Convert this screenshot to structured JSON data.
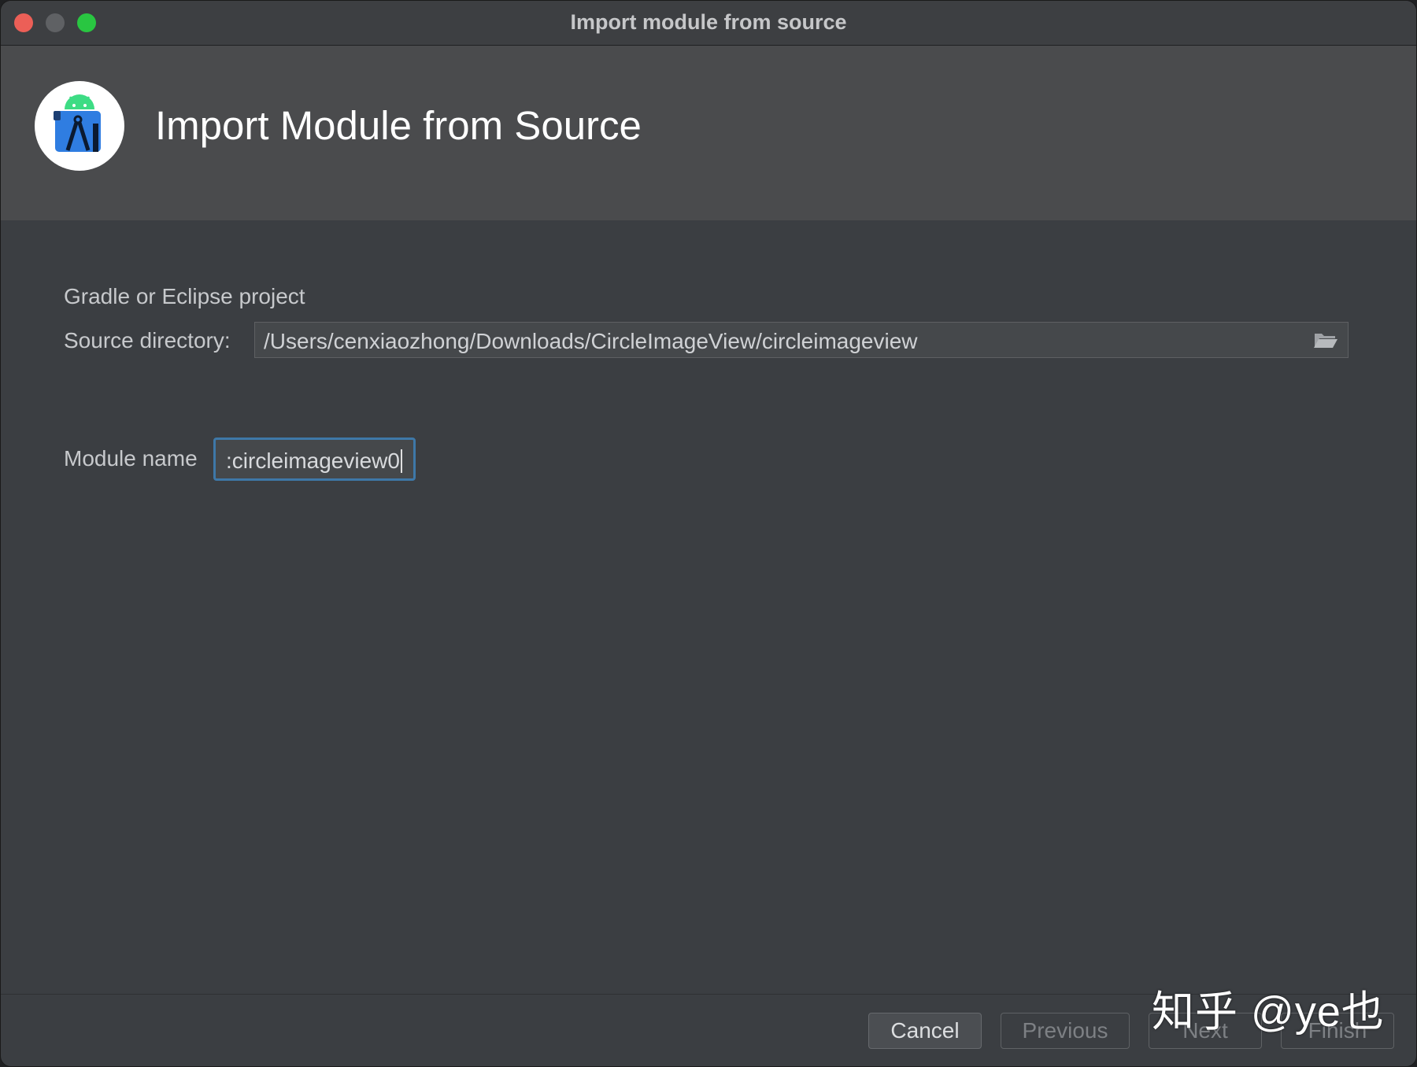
{
  "window": {
    "title": "Import module from source",
    "traffic_lights": {
      "close": "#ec5f57",
      "minimize": "#5f6164",
      "maximize": "#29c641"
    }
  },
  "header": {
    "title": "Import Module from Source",
    "logo_icon": "android-studio-icon"
  },
  "form": {
    "section_label": "Gradle or Eclipse project",
    "source_directory": {
      "label": "Source directory:",
      "value": "/Users/cenxiaozhong/Downloads/CircleImageView/circleimageview",
      "browse_icon": "folder-open-icon"
    },
    "module_name": {
      "label": "Module name",
      "value": ":circleimageview0",
      "focused": true
    }
  },
  "footer": {
    "buttons": {
      "cancel": "Cancel",
      "previous": "Previous",
      "next": "Next",
      "finish": "Finish"
    }
  },
  "watermark": "知乎 @ye也",
  "colors": {
    "accent_focus": "#3e78a8",
    "background": "#3b3e42",
    "header_background": "#4a4b4d"
  }
}
